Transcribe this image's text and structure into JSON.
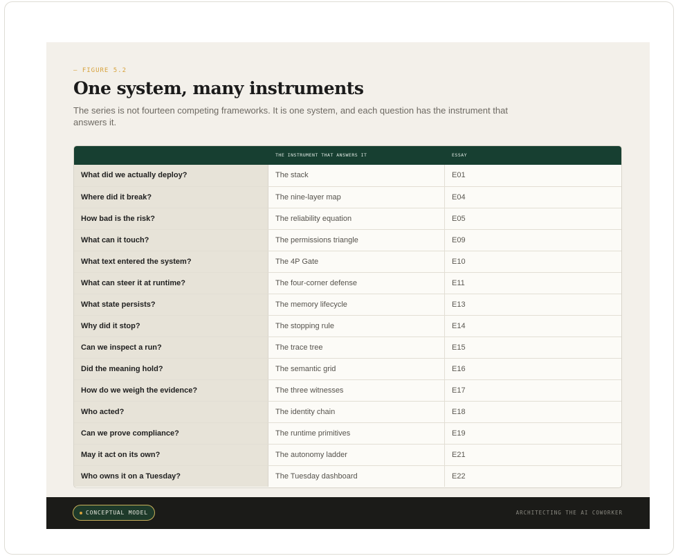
{
  "figure": {
    "eyebrow": "— FIGURE 5.2",
    "title": "One system, many instruments",
    "subtitle": "The series is not fourteen competing frameworks. It is one system, and each question has the instrument that answers it."
  },
  "table": {
    "headers": [
      "",
      "THE INSTRUMENT THAT ANSWERS IT",
      "ESSAY"
    ],
    "rows": [
      {
        "question": "What did we actually deploy?",
        "instrument": "The stack",
        "essay": "E01"
      },
      {
        "question": "Where did it break?",
        "instrument": "The nine-layer map",
        "essay": "E04"
      },
      {
        "question": "How bad is the risk?",
        "instrument": "The reliability equation",
        "essay": "E05"
      },
      {
        "question": "What can it touch?",
        "instrument": "The permissions triangle",
        "essay": "E09"
      },
      {
        "question": "What text entered the system?",
        "instrument": "The 4P Gate",
        "essay": "E10"
      },
      {
        "question": "What can steer it at runtime?",
        "instrument": "The four-corner defense",
        "essay": "E11"
      },
      {
        "question": "What state persists?",
        "instrument": "The memory lifecycle",
        "essay": "E13"
      },
      {
        "question": "Why did it stop?",
        "instrument": "The stopping rule",
        "essay": "E14"
      },
      {
        "question": "Can we inspect a run?",
        "instrument": "The trace tree",
        "essay": "E15"
      },
      {
        "question": "Did the meaning hold?",
        "instrument": "The semantic grid",
        "essay": "E16"
      },
      {
        "question": "How do we weigh the evidence?",
        "instrument": "The three witnesses",
        "essay": "E17"
      },
      {
        "question": "Who acted?",
        "instrument": "The identity chain",
        "essay": "E18"
      },
      {
        "question": "Can we prove compliance?",
        "instrument": "The runtime primitives",
        "essay": "E19"
      },
      {
        "question": "May it act on its own?",
        "instrument": "The autonomy ladder",
        "essay": "E21"
      },
      {
        "question": "Who owns it on a Tuesday?",
        "instrument": "The Tuesday dashboard",
        "essay": "E22"
      }
    ]
  },
  "footer": {
    "badge_label": "CONCEPTUAL MODEL",
    "right_text": "ARCHITECTING THE AI COWORKER"
  },
  "colors": {
    "accent": "#d7a23c",
    "header_green": "#173f31",
    "footer_dark": "#1b1b18",
    "figure_bg": "#f3f0ea"
  }
}
